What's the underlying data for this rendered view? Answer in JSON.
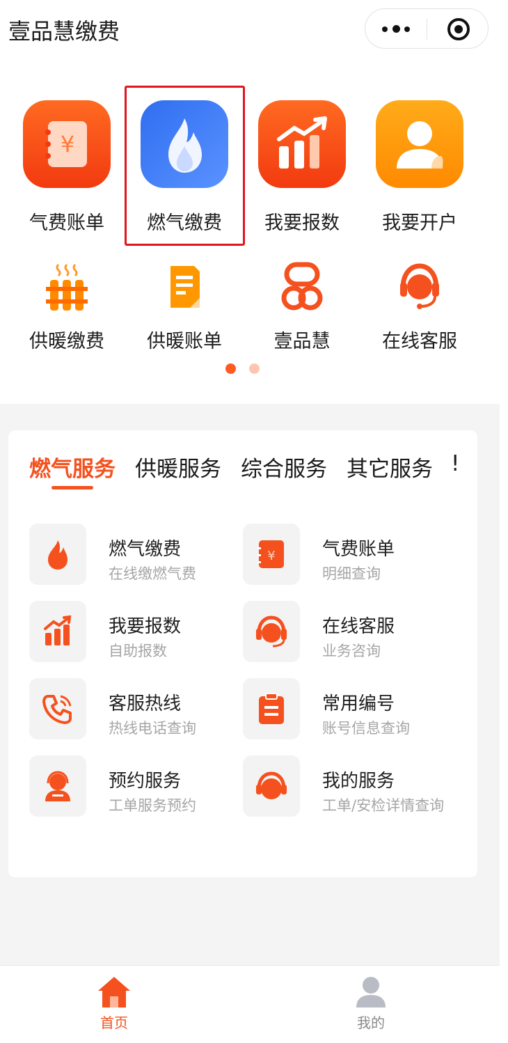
{
  "app": {
    "title": "壹品慧缴费"
  },
  "quick_grid": {
    "primary": [
      {
        "label": "气费账单",
        "icon": "bill-icon"
      },
      {
        "label": "燃气缴费",
        "icon": "flame-icon"
      },
      {
        "label": "我要报数",
        "icon": "chart-icon"
      },
      {
        "label": "我要开户",
        "icon": "user-icon"
      }
    ],
    "secondary": [
      {
        "label": "供暖缴费",
        "icon": "radiator-icon"
      },
      {
        "label": "供暖账单",
        "icon": "document-icon"
      },
      {
        "label": "壹品慧",
        "icon": "brand-logo-icon"
      },
      {
        "label": "在线客服",
        "icon": "headset-icon"
      }
    ],
    "page_indicator": {
      "current": 1,
      "total": 2
    }
  },
  "service_tabs": [
    "燃气服务",
    "供暖服务",
    "综合服务",
    "其它服务",
    "!"
  ],
  "services": [
    {
      "title": "燃气缴费",
      "subtitle": "在线缴燃气费",
      "icon": "flame-icon"
    },
    {
      "title": "气费账单",
      "subtitle": "明细查询",
      "icon": "bill-icon"
    },
    {
      "title": "我要报数",
      "subtitle": "自助报数",
      "icon": "chart-icon"
    },
    {
      "title": "在线客服",
      "subtitle": "业务咨询",
      "icon": "headset-icon"
    },
    {
      "title": "客服热线",
      "subtitle": "热线电话查询",
      "icon": "phone-icon"
    },
    {
      "title": "常用编号",
      "subtitle": "账号信息查询",
      "icon": "clipboard-icon"
    },
    {
      "title": "预约服务",
      "subtitle": "工单服务预约",
      "icon": "agent-icon"
    },
    {
      "title": "我的服务",
      "subtitle": "工单/安检详情查询",
      "icon": "service-icon"
    }
  ],
  "bottom_nav": [
    {
      "label": "首页",
      "icon": "home-icon",
      "active": true
    },
    {
      "label": "我的",
      "icon": "profile-icon",
      "active": false
    }
  ],
  "colors": {
    "accent": "#f4511e",
    "highlight_box": "#e0151e",
    "blue_tile": "#3f7bf5"
  }
}
